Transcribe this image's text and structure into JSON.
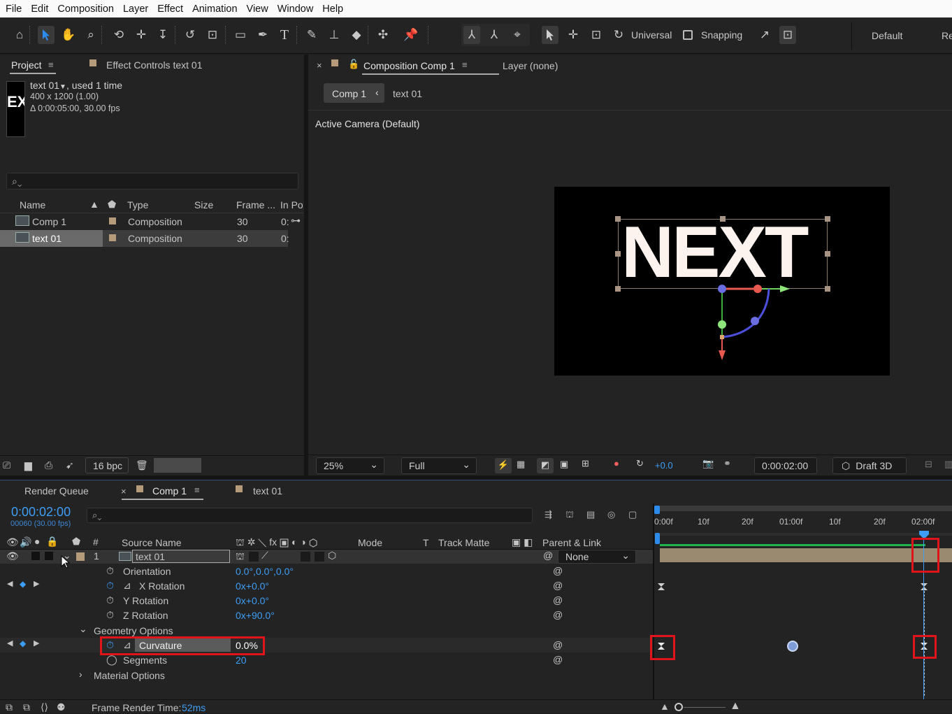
{
  "menu": [
    "File",
    "Edit",
    "Composition",
    "Layer",
    "Effect",
    "Animation",
    "View",
    "Window",
    "Help"
  ],
  "toolbar": {
    "axis_mode": "Universal",
    "snapping": "Snapping",
    "workspace": "Default",
    "workspace_next": "Re"
  },
  "project_panel": {
    "tab": "Project",
    "effect_controls_tab": "Effect Controls text 01",
    "item_name": "text 01",
    "used": ", used 1 time",
    "dims": "400 x 1200 (1.00)",
    "duration": "Δ 0:00:05:00, 30.00 fps",
    "thumb_text": "EX",
    "columns": [
      "Name",
      "Type",
      "Size",
      "Frame ...",
      "In Po"
    ],
    "items": [
      {
        "name": "Comp 1",
        "type": "Composition",
        "frame": "30",
        "inpoint": "0:"
      },
      {
        "name": "text 01",
        "type": "Composition",
        "frame": "30",
        "inpoint": "0:"
      }
    ],
    "bpc": "16 bpc"
  },
  "comp_panel": {
    "tab": "Composition Comp 1",
    "layer_tab": "Layer (none)",
    "breadcrumb_comp": "Comp 1",
    "breadcrumb_layer": "text 01",
    "camera_label": "Active Camera (Default)",
    "canvas_text": "NEXT",
    "zoom": "25%",
    "resolution": "Full",
    "exposure": "+0.0",
    "timecode": "0:00:02:00",
    "renderer": "Draft 3D"
  },
  "timeline": {
    "render_queue_tab": "Render Queue",
    "comp_tab": "Comp 1",
    "text_tab": "text 01",
    "current_time": "0:00:02:00",
    "frame_info": "00060 (30.00 fps)",
    "columns": {
      "num": "#",
      "source": "Source Name",
      "mode": "Mode",
      "t": "T",
      "track_matte": "Track Matte",
      "parent": "Parent & Link"
    },
    "ruler": [
      "0:00f",
      "10f",
      "20f",
      "01:00f",
      "10f",
      "20f",
      "02:00f"
    ],
    "layer": {
      "number": "1",
      "name": "text 01",
      "parent": "None"
    },
    "properties": [
      {
        "label": "Orientation",
        "value": "0.0°,0.0°,0.0°"
      },
      {
        "label": "X Rotation",
        "value": "0x+0.0°"
      },
      {
        "label": "Y Rotation",
        "value": "0x+0.0°"
      },
      {
        "label": "Z Rotation",
        "value": "0x+90.0°"
      }
    ],
    "geometry_group": "Geometry Options",
    "curvature": {
      "label": "Curvature",
      "value": "0.0%"
    },
    "segments": {
      "label": "Segments",
      "value": "20"
    },
    "material_group": "Material Options",
    "render_time_label": "Frame Render Time:",
    "render_time_value": "52ms"
  },
  "colors": {
    "accent_blue": "#3d9df5",
    "highlight_red": "#e0141b",
    "label_tan": "#b69b7a"
  }
}
